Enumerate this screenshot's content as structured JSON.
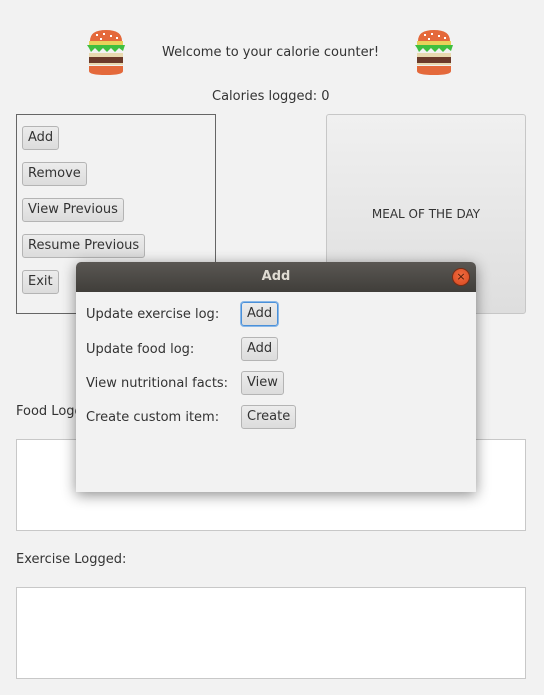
{
  "header": {
    "welcome_text": "Welcome to your calorie counter!",
    "calories_text": "Calories logged: 0",
    "left_icon": "burger-icon",
    "right_icon": "burger-icon"
  },
  "menu": {
    "add_label": "Add",
    "remove_label": "Remove",
    "view_previous_label": "View Previous",
    "resume_previous_label": "Resume Previous",
    "exit_label": "Exit"
  },
  "meal_of_the_day": {
    "label": "MEAL OF THE DAY"
  },
  "food_log": {
    "label": "Food Logged:"
  },
  "exercise_log": {
    "label": "Exercise Logged:"
  },
  "dialog": {
    "title": "Add",
    "close_icon": "close-icon",
    "rows": {
      "exercise": {
        "label": "Update exercise log:",
        "button": "Add"
      },
      "food": {
        "label": "Update food log:",
        "button": "Add"
      },
      "nutrition": {
        "label": "View nutritional facts:",
        "button": "View"
      },
      "custom": {
        "label": "Create custom item:",
        "button": "Create"
      }
    }
  },
  "colors": {
    "background": "#f2f2f2",
    "titlebar": "#4a4743",
    "close_button": "#e8552a",
    "focus": "#4a90d9"
  }
}
